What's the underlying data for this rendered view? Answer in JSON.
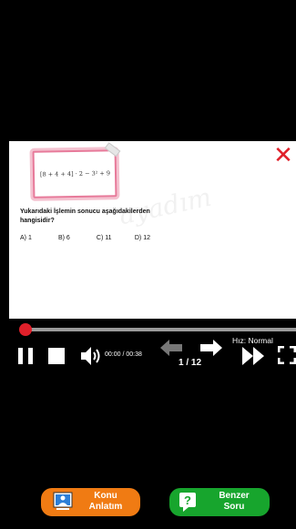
{
  "question": {
    "formula": "[8 + 4 + 4] · 2 − 3² + 9",
    "text": "Yukarıdaki İşlemin sonucu aşağıdakilerden hangisidir?",
    "options": [
      "A) 1",
      "B) 6",
      "C) 11",
      "D) 12"
    ]
  },
  "player": {
    "time": "00:00 / 00:38",
    "page": "1 / 12",
    "speed": "Hız: Normal",
    "progress": 0
  },
  "buttons": {
    "konu": "Konu\nAnlatım",
    "benzer": "Benzer\nSoru"
  },
  "icons": {
    "close": "close-icon",
    "pause": "pause-icon",
    "stop": "stop-icon",
    "volume": "speaker-icon",
    "prev": "arrow-left-icon",
    "next": "arrow-right-icon",
    "speed": "fast-forward-icon",
    "fullscreen": "fullscreen-icon",
    "konu": "teacher-board-icon",
    "benzer": "question-mark-icon"
  },
  "colors": {
    "close": "#e0202a",
    "knob": "#e0202a",
    "konu": "#f07b13",
    "benzer": "#17a52d"
  }
}
